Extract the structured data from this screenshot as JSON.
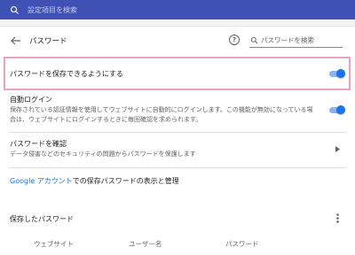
{
  "topbar": {
    "search_placeholder": "設定項目を検索"
  },
  "header": {
    "title": "パスワード",
    "search_placeholder": "パスワードを検索"
  },
  "settings": {
    "offer_to_save": {
      "label": "パスワードを保存できるようにする",
      "enabled": true
    },
    "auto_signin": {
      "label": "自動ログイン",
      "description": "保存されている認証情報を使用してウェブサイトに自動的にログインします。この機能が無効になっている場合は、ウェブサイトにログインするときに毎回確認を求められます。",
      "enabled": true
    },
    "check_passwords": {
      "label": "パスワードを確認",
      "description": "データ侵害などのセキュリティの問題からパスワードを保護します"
    },
    "google_account": {
      "link_text": "Google アカウント",
      "suffix": "での保存パスワードの表示と管理"
    }
  },
  "saved_passwords": {
    "title": "保存したパスワード",
    "columns": [
      "ウェブサイト",
      "ユーザー名",
      "パスワード"
    ]
  },
  "colors": {
    "topbar": "#3f51b5",
    "accent": "#1a73e8",
    "highlight": "#e8a3c0"
  }
}
